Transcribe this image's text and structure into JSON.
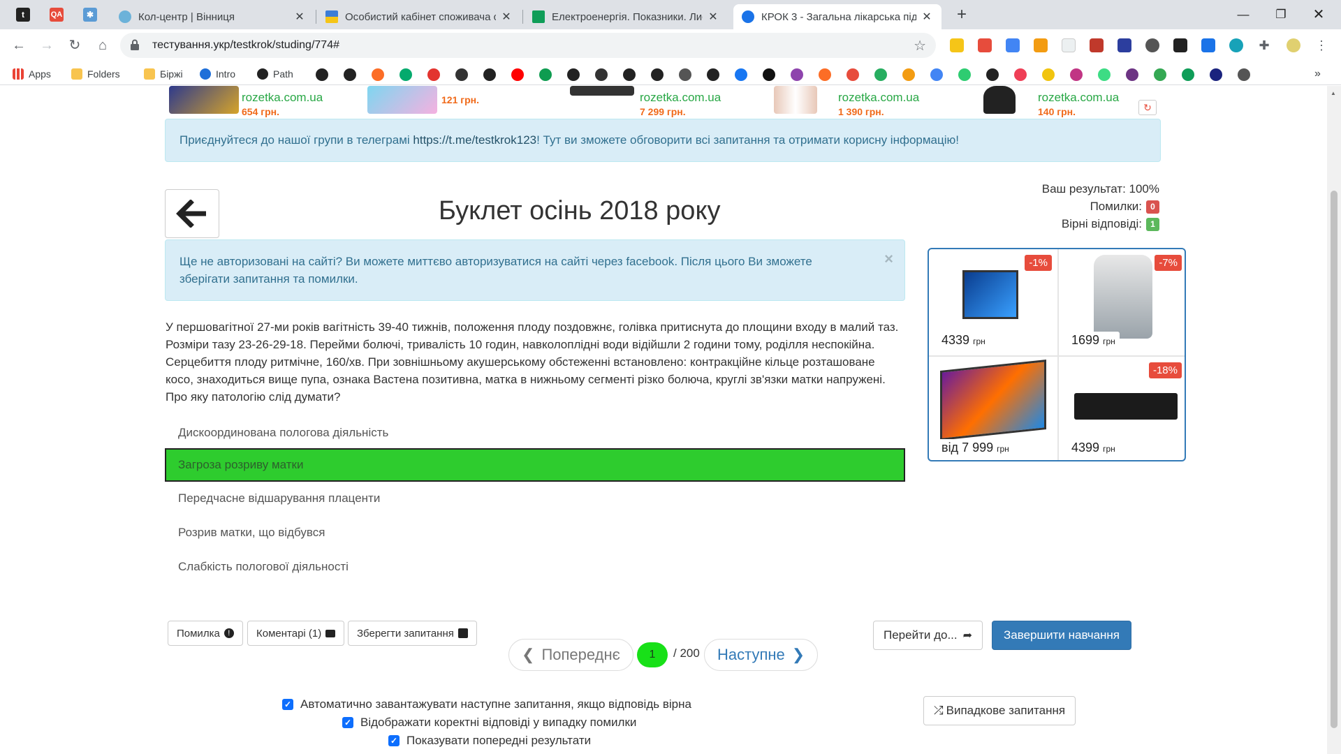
{
  "browser": {
    "pinned_tabs": [
      {
        "icon": "tumblr-icon",
        "label": "t",
        "color": "#222222"
      },
      {
        "icon": "qa-icon",
        "label": "QA",
        "color": "#e74c3c"
      },
      {
        "icon": "extension-icon",
        "label": "",
        "color": "#5b9bd5"
      }
    ],
    "tabs": [
      {
        "title": "Кол-центр | Вінниця",
        "icon": "site-icon",
        "color": "#6cb2d9",
        "active": false
      },
      {
        "title": "Особистий кабінет споживача с",
        "icon": "ukraine-flag-icon",
        "color": "#f5c518",
        "active": false
      },
      {
        "title": "Електроенергія. Показники. Лис",
        "icon": "sheets-icon",
        "color": "#0f9d58",
        "active": false
      },
      {
        "title": "КРОК 3 - Загальна лікарська під",
        "icon": "upload-icon",
        "color": "#1a73e8",
        "active": true
      }
    ],
    "url": "тестування.укр/testkrok/studing/774#",
    "bookmarks": [
      {
        "label": "Apps",
        "icon": "apps-grid-icon",
        "color": "#ea4335"
      },
      {
        "label": "Folders",
        "icon": "folder-icon",
        "color": "#f8c44f"
      },
      {
        "label": "Біржі",
        "icon": "folder-icon",
        "color": "#f8c44f"
      },
      {
        "label": "Intro",
        "icon": "react-icon",
        "color": "#1e6fd9"
      },
      {
        "label": "Path",
        "icon": "github-icon",
        "color": "#222222"
      }
    ],
    "bookmark_icons": [
      {
        "icon": "github-icon",
        "color": "#222222"
      },
      {
        "icon": "github-icon",
        "color": "#222222"
      },
      {
        "icon": "gitlab-icon",
        "color": "#fc6d26"
      },
      {
        "icon": "w3schools-icon",
        "color": "#04aa6d"
      },
      {
        "icon": "codepen-icon",
        "color": "#e3342f"
      },
      {
        "icon": "bookmark-icon",
        "color": "#333333"
      },
      {
        "icon": "dou-icon",
        "color": "#222222"
      },
      {
        "icon": "youtube-icon",
        "color": "#ff0000"
      },
      {
        "icon": "flaticon-icon",
        "color": "#0e9c50"
      },
      {
        "icon": "skype-icon",
        "color": "#222222"
      },
      {
        "icon": "book-icon",
        "color": "#333333"
      },
      {
        "icon": "skype-icon",
        "color": "#222222"
      },
      {
        "icon": "github-icon",
        "color": "#222222"
      },
      {
        "icon": "globe-icon",
        "color": "#555555"
      },
      {
        "icon": "w-icon",
        "color": "#222222"
      },
      {
        "icon": "facebook-icon",
        "color": "#1877f2"
      },
      {
        "icon": "ch-icon",
        "color": "#111111"
      },
      {
        "icon": "ua-icon",
        "color": "#8e44ad"
      },
      {
        "icon": "gitlab-icon",
        "color": "#fc6d26"
      },
      {
        "icon": "asterisk-icon",
        "color": "#e74c3c"
      },
      {
        "icon": "code-icon",
        "color": "#27ae60"
      },
      {
        "icon": "h-icon",
        "color": "#f39c12"
      },
      {
        "icon": "translate-icon",
        "color": "#4285f4"
      },
      {
        "icon": "ed-icon",
        "color": "#2ecc71"
      },
      {
        "icon": "github-icon",
        "color": "#222222"
      },
      {
        "icon": "pocket-icon",
        "color": "#ef3f56"
      },
      {
        "icon": "bolt-icon",
        "color": "#f1c40f"
      },
      {
        "icon": "instagram-icon",
        "color": "#c13584"
      },
      {
        "icon": "android-icon",
        "color": "#3ddc84"
      },
      {
        "icon": "square-icon",
        "color": "#6c3483"
      },
      {
        "icon": "maps-icon",
        "color": "#34a853"
      },
      {
        "icon": "plus-icon",
        "color": "#0f9d58"
      },
      {
        "icon": "circle-icon",
        "color": "#1a237e"
      },
      {
        "icon": "globe-icon",
        "color": "#555555"
      }
    ]
  },
  "ads": [
    {
      "store": "rozetka.com.ua",
      "price": "654 грн."
    },
    {
      "store": "",
      "price": "121 грн."
    },
    {
      "store": "rozetka.com.ua",
      "price": "7 299 грн."
    },
    {
      "store": "rozetka.com.ua",
      "price": "1 390 грн."
    },
    {
      "store": "rozetka.com.ua",
      "price": "140 грн."
    }
  ],
  "telegram_notice": {
    "before": "Приєднуйтеся до нашої групи в телеграмі ",
    "link": "https://t.me/testkrok123",
    "after": "! Тут ви зможете обговорити всі запитання та отримати корисну інформацію!"
  },
  "page_title": "Буклет осінь 2018 року",
  "result": {
    "score_label": "Ваш результат: 100%",
    "errors_label": "Помилки:",
    "errors_count": "0",
    "correct_label": "Вірні відповіді:",
    "correct_count": "1"
  },
  "auth_notice": {
    "before": "Ще не авторизовані на сайті? Ви можете миттєво ",
    "link": "авторизуватися на сайті через facebook",
    "after": ". Після цього Ви зможете зберігати запитання та помилки.",
    "close": "×"
  },
  "question": "У першовагітної 27-ми років вагітність 39-40 тижнів, положення плоду поздовжнє, голівка притиснута до площини входу в малий таз. Розміри тазу 23-26-29-18. Перейми болючі, тривалість 10 годин, навколоплідні води відійшли 2 години тому, роділля неспокійна. Серцебиття плоду ритмічне, 160/хв. При зовнішньому акушерському обстеженні встановлено: контракційне кільце розташоване косо, знаходиться вище пупа, ознака Вастена позитивна, матка в нижньому сегменті різко болюча, круглі зв'язки матки напружені. Про яку патологію слід думати?",
  "answers": [
    {
      "text": "Дискоординована пологова діяльність",
      "correct": false
    },
    {
      "text": "Загроза розриву матки",
      "correct": true
    },
    {
      "text": "Передчасне відшарування плаценти",
      "correct": false
    },
    {
      "text": "Розрив матки, що відбувся",
      "correct": false
    },
    {
      "text": "Слабкість пологової діяльності",
      "correct": false
    }
  ],
  "promo": [
    {
      "price": "4339",
      "unit": "грн",
      "discount": "-1%"
    },
    {
      "price": "1699",
      "unit": "грн",
      "discount": "-7%"
    },
    {
      "price": "від 7 999",
      "unit": "грн",
      "discount": ""
    },
    {
      "price": "4399",
      "unit": "грн",
      "discount": "-18%"
    }
  ],
  "actions": {
    "mistake": "Помилка",
    "comments": "Коментарі (1)",
    "save": "Зберегти запитання",
    "prev": "Попереднє",
    "page": "1",
    "total": "/ 200",
    "next": "Наступне",
    "goto": "Перейти до...",
    "finish": "Завершити навчання",
    "random": "Випадкове запитання"
  },
  "options": [
    {
      "label": "Автоматично завантажувати наступне запитання, якщо відповідь вірна",
      "checked": true
    },
    {
      "label": "Відображати коректні відповіді у випадку помилки",
      "checked": true
    },
    {
      "label": "Показувати попередні результати",
      "checked": true
    }
  ],
  "colors": {
    "correct_answer": "#2ecc2e",
    "info_bg": "#d9edf7",
    "primary": "#337ab7",
    "error_badge": "#d9534f",
    "success_badge": "#5cb85c"
  }
}
